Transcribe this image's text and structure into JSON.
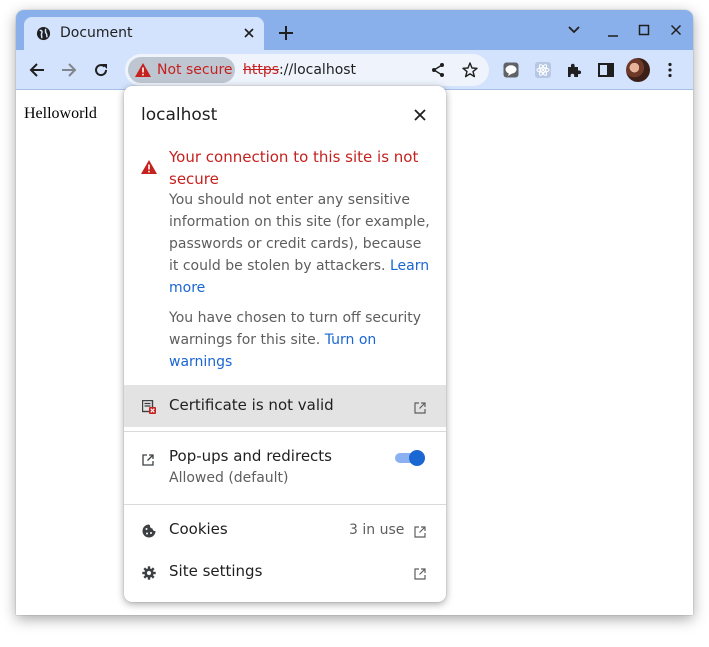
{
  "tab": {
    "title": "Document"
  },
  "omnibox": {
    "security_chip": "Not secure",
    "url_scheme": "https",
    "url_rest": "://localhost"
  },
  "page": {
    "text": "Helloworld"
  },
  "popup": {
    "host": "localhost",
    "warning_heading": "Your connection to this site is not secure",
    "warning_body": "You should not enter any sensitive information on this site (for example, passwords or credit cards), because it could be stolen by attackers.",
    "learn_more": "Learn more",
    "disabled_body": "You have chosen to turn off security warnings for this site.",
    "turn_on": "Turn on warnings",
    "certificate": "Certificate is not valid",
    "popups_label": "Pop-ups and redirects",
    "popups_status": "Allowed (default)",
    "popups_enabled": true,
    "cookies_label": "Cookies",
    "cookies_count": "3 in use",
    "site_settings": "Site settings"
  },
  "colors": {
    "titlebar": "#8ab0eb",
    "toolbar": "#d3e3fd",
    "danger": "#c5221f",
    "link": "#1a66d2"
  }
}
